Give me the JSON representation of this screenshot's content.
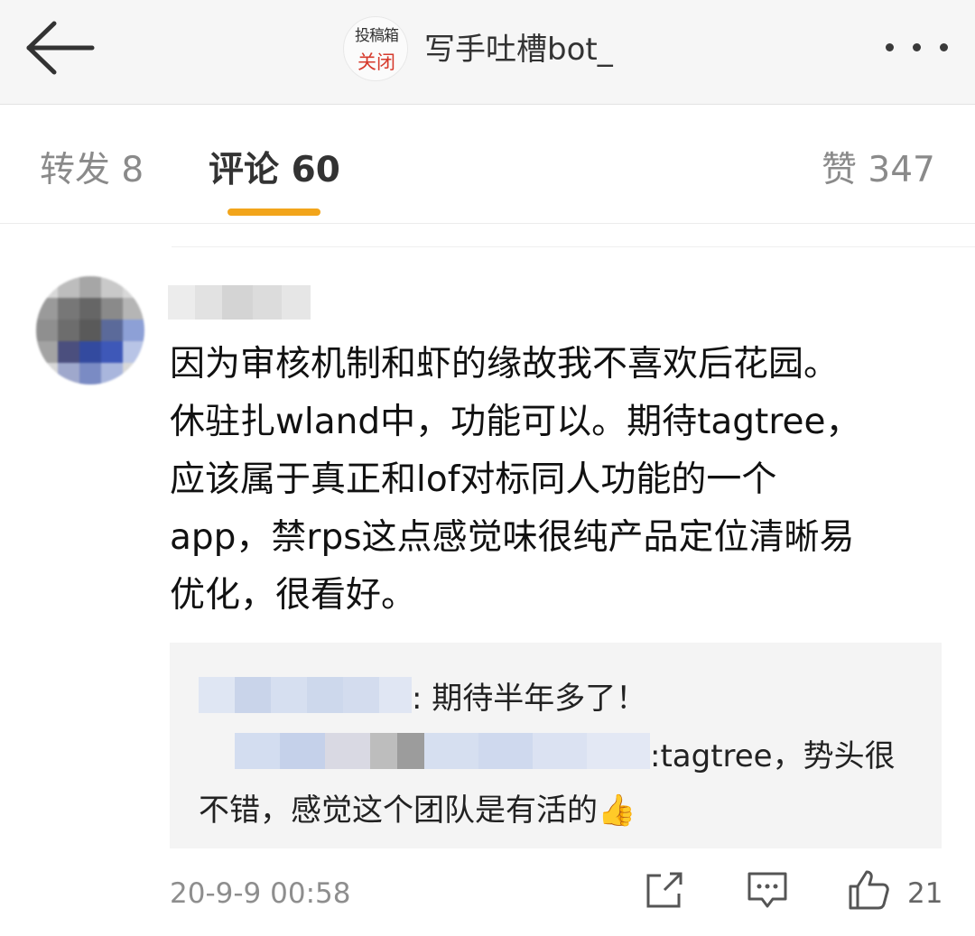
{
  "header": {
    "avatar_text_top": "投稿箱",
    "avatar_text_bottom": "关闭",
    "title": "写手吐槽bot_",
    "back_icon": "arrow-left-icon",
    "more_icon": "more-dots-icon"
  },
  "tabs": [
    {
      "label": "转发 8"
    },
    {
      "label": "评论 60"
    },
    {
      "label": "赞 347"
    }
  ],
  "accent_color": "#f2a51b",
  "comment": {
    "lines": [
      "因为审核机制和虾的缘故我不喜欢后花园。",
      "休驻扎wland中，功能可以。期待tagtree，",
      "应该属于真正和lof对标同人功能的一个",
      "app，禁rps这点感觉味很纯产品定位清晰易",
      "优化，很看好。"
    ],
    "replies": [
      {
        "text": ": 期待半年多了！"
      },
      {
        "text": ":tagtree，势头很",
        "text_cont": "不错，感觉这个团队是有活的"
      }
    ],
    "thumbs_emoji": "👍",
    "timestamp": "20-9-9 00:58",
    "like_count": "21"
  }
}
